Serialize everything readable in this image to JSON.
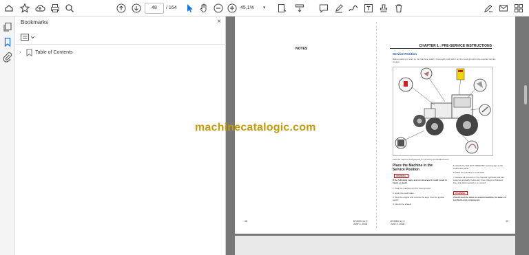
{
  "toolbar": {
    "page_number": "48",
    "page_total": "/ 164",
    "zoom": "45,1%",
    "zoom_chevron": "▾"
  },
  "bookmarks": {
    "title": "Bookmarks",
    "close": "×",
    "options_chevron": "▾",
    "items": [
      {
        "label": "Table of Contents",
        "chevron": "›"
      }
    ]
  },
  "document": {
    "left_page": {
      "title": "NOTES",
      "footer_page": "48",
      "footer_ref": "874953 rev 0\nJune 3, 2008"
    },
    "right_page": {
      "chapter": "CHAPTER 1 : PRE-SERVICE INSTRUCTIONS",
      "heading": "Service Position",
      "intro": "Before starting to work on the machine, wash it thoroughly and park it on firm level ground in the required service position.",
      "caption": "Park the machine and prepare for servicing as detailed below.",
      "heading2": "Place the Machine in the Service Position",
      "warning1": "WARNING",
      "warning1_text": "If the following steps are not observed it could result in injury or death.",
      "step1": "1. Park the machine on firm, level ground.",
      "step2": "2. Apply the park brake.",
      "step3": "3. Stop the engine and remove the keys from the ignition switch.",
      "step4": "4. Check the wheels.",
      "step5": "5. Attach the \"DO NOT OPERATE\" warning sign to the instrument panel.",
      "step6": "6. Allow the machine to cool down.",
      "step7": "7. Relieve all pressure in the relevant hydraulic and fuel systems gradually, before any lines, fittings or blanked lines are disconnected or re-moved.",
      "warning2": "WARNING",
      "warning2_text": "If work must be done on a warm machine, be aware of hot fluids and components.",
      "footer_ref": "874953 rev 0\nJune 3, 2008",
      "footer_page": "49"
    }
  },
  "watermark": "machinecatalogic.com",
  "colors": {
    "accent": "#1473e6",
    "watermark": "#c59a05",
    "doc_bg": "#777777",
    "warning": "#bb1111"
  }
}
